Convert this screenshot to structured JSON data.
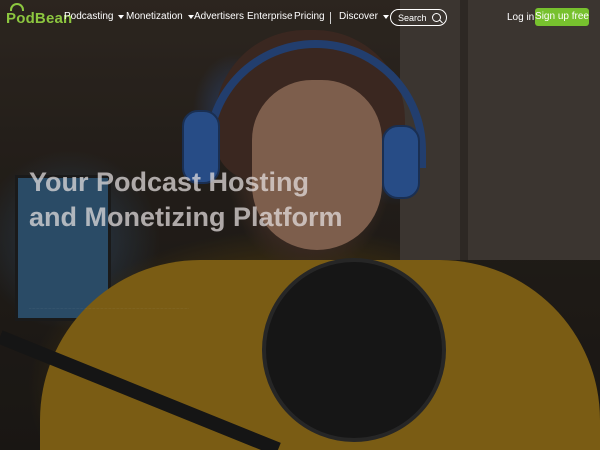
{
  "brand": {
    "logo_text": "PodBean",
    "accent_color": "#77c12e"
  },
  "nav": {
    "items": [
      {
        "label": "Podcasting",
        "has_dropdown": true
      },
      {
        "label": "Monetization",
        "has_dropdown": true
      },
      {
        "label": "Advertisers",
        "has_dropdown": false
      },
      {
        "label": "Enterprise",
        "has_dropdown": false
      },
      {
        "label": "Pricing",
        "has_dropdown": false
      },
      {
        "label": "Discover",
        "has_dropdown": true
      }
    ],
    "search_label": "Search",
    "login_label": "Log in",
    "signup_label": "Sign up free"
  },
  "hero": {
    "headline_line1": "Your Podcast Hosting",
    "headline_line2": "and Monetizing Platform",
    "subtext": "........................................................................................................................"
  }
}
